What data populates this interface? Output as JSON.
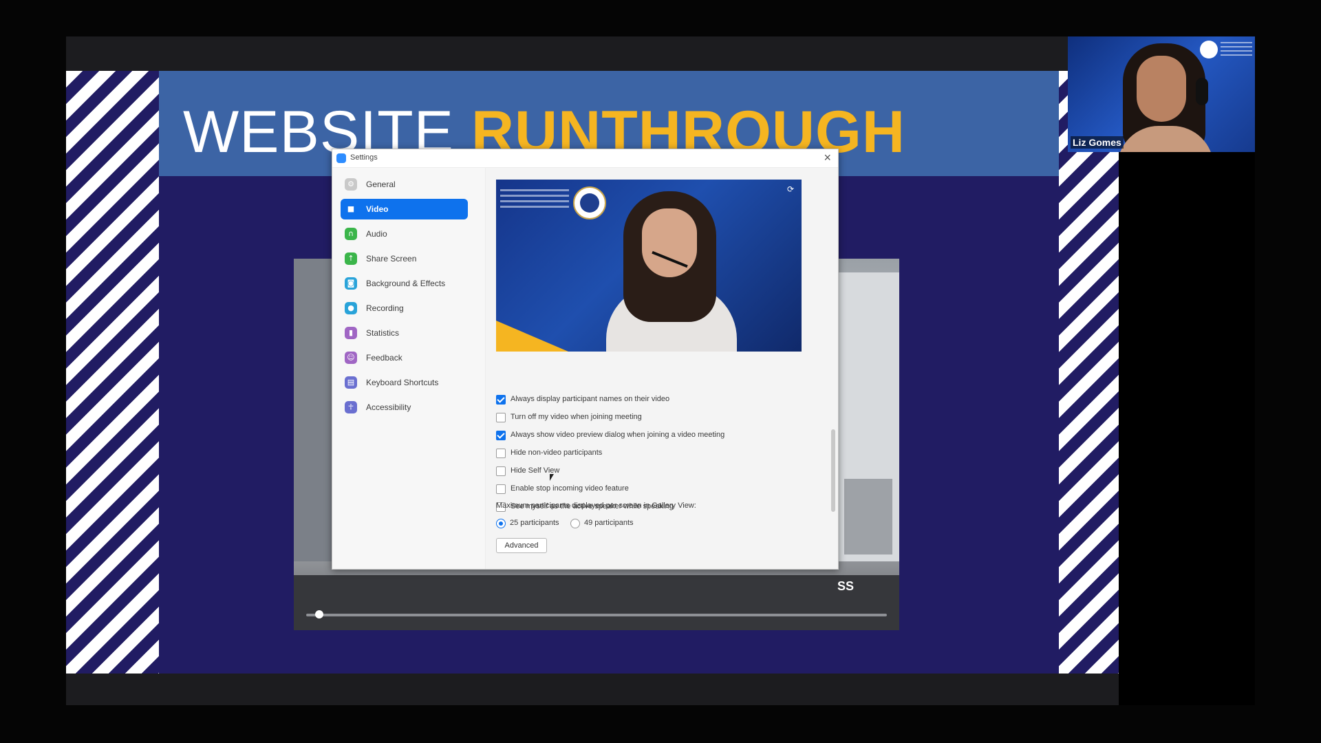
{
  "slide": {
    "title_white": "WEBSITE",
    "title_yellow": "RUNTHROUGH",
    "colors": {
      "navy": "#211c63",
      "banner": "#3c64a5",
      "accent": "#f5b521"
    }
  },
  "player": {
    "caption": "SS",
    "progress": 0.015
  },
  "dialog": {
    "title": "Settings",
    "close_icon": "close-icon",
    "nav": [
      {
        "label": "General",
        "icon": "gear-icon",
        "color": "#c9c9c9",
        "glyph": "⚙",
        "active": false
      },
      {
        "label": "Video",
        "icon": "video-camera-icon",
        "color": "#0e72ed",
        "glyph": "■",
        "active": true
      },
      {
        "label": "Audio",
        "icon": "headphones-icon",
        "color": "#3bb54a",
        "glyph": "∩",
        "active": false
      },
      {
        "label": "Share Screen",
        "icon": "share-screen-icon",
        "color": "#3bb54a",
        "glyph": "↑",
        "active": false
      },
      {
        "label": "Background & Effects",
        "icon": "background-icon",
        "color": "#29a3d9",
        "glyph": "◙",
        "active": false
      },
      {
        "label": "Recording",
        "icon": "recording-icon",
        "color": "#29a3d9",
        "glyph": "●",
        "active": false
      },
      {
        "label": "Statistics",
        "icon": "statistics-icon",
        "color": "#a066c4",
        "glyph": "▮",
        "active": false
      },
      {
        "label": "Feedback",
        "icon": "feedback-icon",
        "color": "#a066c4",
        "glyph": "☺",
        "active": false
      },
      {
        "label": "Keyboard Shortcuts",
        "icon": "keyboard-icon",
        "color": "#6a6fd0",
        "glyph": "▤",
        "active": false
      },
      {
        "label": "Accessibility",
        "icon": "accessibility-icon",
        "color": "#6a6fd0",
        "glyph": "☥",
        "active": false
      }
    ],
    "video_options": [
      {
        "label": "Always display participant names on their video",
        "checked": true
      },
      {
        "label": "Turn off my video when joining meeting",
        "checked": false
      },
      {
        "label": "Always show video preview dialog when joining a video meeting",
        "checked": true
      },
      {
        "label": "Hide non-video participants",
        "checked": false
      },
      {
        "label": "Hide Self View",
        "checked": false
      },
      {
        "label": "Enable stop incoming video feature",
        "checked": false
      },
      {
        "label": "See myself as the active speaker while speaking",
        "checked": false
      }
    ],
    "gallery_label": "Maximum participants displayed per screen in Gallery View:",
    "gallery_options": [
      {
        "label": "25 participants",
        "selected": true
      },
      {
        "label": "49 participants",
        "selected": false
      }
    ],
    "advanced_label": "Advanced"
  },
  "participant": {
    "name": "Liz Gomes"
  }
}
